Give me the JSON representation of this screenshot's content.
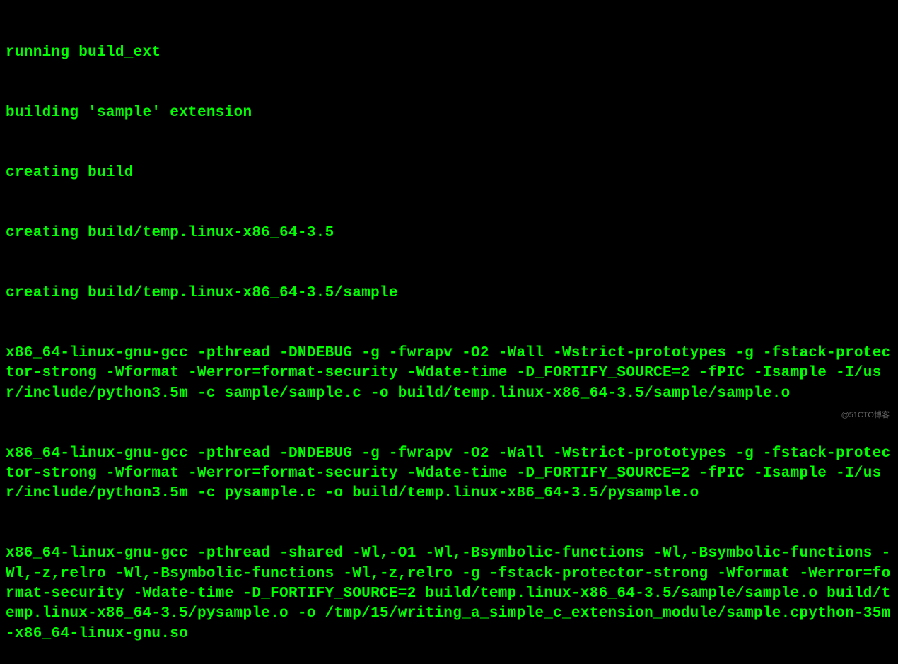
{
  "terminal": {
    "lines": [
      "running build_ext",
      "building 'sample' extension",
      "creating build",
      "creating build/temp.linux-x86_64-3.5",
      "creating build/temp.linux-x86_64-3.5/sample",
      "x86_64-linux-gnu-gcc -pthread -DNDEBUG -g -fwrapv -O2 -Wall -Wstrict-prototypes -g -fstack-protector-strong -Wformat -Werror=format-security -Wdate-time -D_FORTIFY_SOURCE=2 -fPIC -Isample -I/usr/include/python3.5m -c sample/sample.c -o build/temp.linux-x86_64-3.5/sample/sample.o",
      "x86_64-linux-gnu-gcc -pthread -DNDEBUG -g -fwrapv -O2 -Wall -Wstrict-prototypes -g -fstack-protector-strong -Wformat -Werror=format-security -Wdate-time -D_FORTIFY_SOURCE=2 -fPIC -Isample -I/usr/include/python3.5m -c pysample.c -o build/temp.linux-x86_64-3.5/pysample.o",
      "x86_64-linux-gnu-gcc -pthread -shared -Wl,-O1 -Wl,-Bsymbolic-functions -Wl,-Bsymbolic-functions -Wl,-z,relro -Wl,-Bsymbolic-functions -Wl,-z,relro -g -fstack-protector-strong -Wformat -Werror=format-security -Wdate-time -D_FORTIFY_SOURCE=2 build/temp.linux-x86_64-3.5/sample/sample.o build/temp.linux-x86_64-3.5/pysample.o -o /tmp/15/writing_a_simple_c_extension_module/sample.cpython-35m-x86_64-linux-gnu.so"
    ]
  },
  "watermark": {
    "text": "@51CTO博客"
  }
}
